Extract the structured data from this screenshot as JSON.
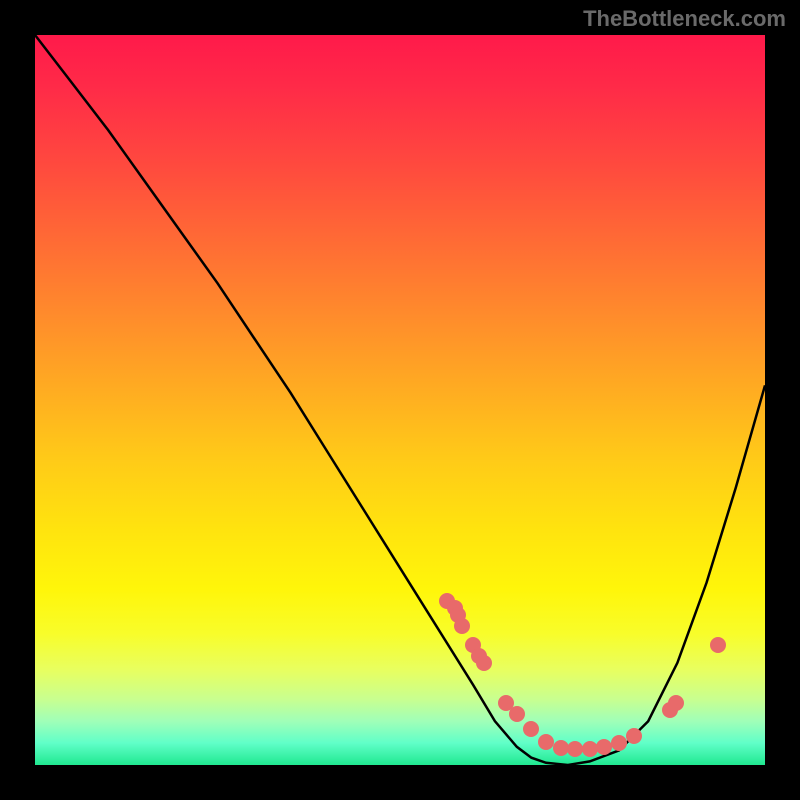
{
  "watermark": "TheBottleneck.com",
  "chart_data": {
    "type": "line",
    "title": "",
    "xlabel": "",
    "ylabel": "",
    "xlim": [
      0,
      100
    ],
    "ylim": [
      0,
      100
    ],
    "series": [
      {
        "name": "curve",
        "x": [
          0,
          5,
          10,
          15,
          20,
          25,
          30,
          35,
          40,
          45,
          50,
          55,
          60,
          63,
          66,
          68,
          70,
          73,
          76,
          80,
          84,
          88,
          92,
          96,
          100
        ],
        "y": [
          100,
          93.5,
          87,
          80,
          73,
          66,
          58.5,
          51,
          43,
          35,
          27,
          19,
          11,
          6,
          2.5,
          1,
          0.3,
          0,
          0.5,
          2,
          6,
          14,
          25,
          38,
          52
        ]
      }
    ],
    "markers": {
      "name": "points",
      "x_pct": [
        56.5,
        57.5,
        58.0,
        58.5,
        60.0,
        60.8,
        61.5,
        64.5,
        66.0,
        68.0,
        70.0,
        72.0,
        74.0,
        76.0,
        78.0,
        80.0,
        82.0,
        87.0,
        87.8,
        93.5
      ],
      "y_pct": [
        77.5,
        78.5,
        79.5,
        81.0,
        83.5,
        85.0,
        86.0,
        91.5,
        93.0,
        95.0,
        96.8,
        97.7,
        97.8,
        97.8,
        97.5,
        97.0,
        96.0,
        92.5,
        91.5,
        83.5
      ]
    },
    "gradient_stops": [
      {
        "pos": 0,
        "color": "#ff1a4a"
      },
      {
        "pos": 50,
        "color": "#ffca18"
      },
      {
        "pos": 85,
        "color": "#f8fd2a"
      },
      {
        "pos": 100,
        "color": "#20e890"
      }
    ]
  }
}
